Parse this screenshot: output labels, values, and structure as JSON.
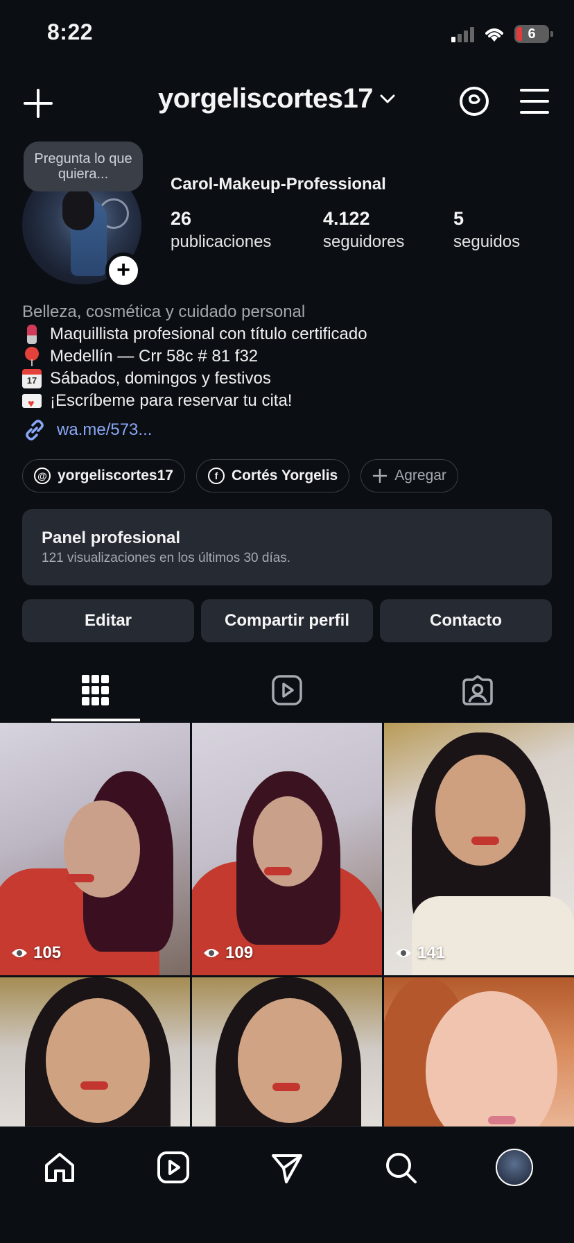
{
  "status_bar": {
    "time": "8:22",
    "battery": "6"
  },
  "header": {
    "username": "yorgeliscortes17"
  },
  "profile": {
    "note": "Pregunta lo que quiera...",
    "display_name": "Carol-Makeup-Professional",
    "stats": [
      {
        "value": "26",
        "label": "publicaciones"
      },
      {
        "value": "4.122",
        "label": "seguidores"
      },
      {
        "value": "5",
        "label": "seguidos"
      }
    ]
  },
  "bio": {
    "category": "Belleza, cosmética y cuidado personal",
    "lines": [
      {
        "icon": "lipstick-emoji",
        "text": "Maquillista profesional con título certificado"
      },
      {
        "icon": "pin-emoji",
        "text": "Medellín — Crr 58c # 81 f32"
      },
      {
        "icon": "calendar-emoji",
        "text": "Sábados, domingos y festivos",
        "calendar_day": "17"
      },
      {
        "icon": "love-letter-emoji",
        "text": "¡Escríbeme para reservar tu cita!"
      }
    ],
    "link": "wa.me/573..."
  },
  "pills": [
    {
      "icon": "threads-icon",
      "label": "yorgeliscortes17"
    },
    {
      "icon": "facebook-icon",
      "label": "Cortés Yorgelis"
    },
    {
      "icon": "plus-icon",
      "label": "Agregar"
    }
  ],
  "panel": {
    "title": "Panel profesional",
    "subtitle": "121 visualizaciones en los últimos 30 días."
  },
  "actions": {
    "edit": "Editar",
    "share": "Compartir perfil",
    "contact": "Contacto"
  },
  "tabs": [
    "grid-icon",
    "reels-icon",
    "tagged-icon"
  ],
  "grid": [
    {
      "views": "105"
    },
    {
      "views": "109"
    },
    {
      "views": "141"
    },
    {
      "views": ""
    },
    {
      "views": ""
    },
    {
      "views": ""
    }
  ],
  "bottom_nav": [
    "home-icon",
    "reels-icon",
    "messages-icon",
    "search-icon",
    "profile-avatar"
  ],
  "colors": {
    "background": "#0b0f14",
    "card": "#262b33",
    "link": "#8aa7f5",
    "muted_text": "#a7abb1"
  }
}
